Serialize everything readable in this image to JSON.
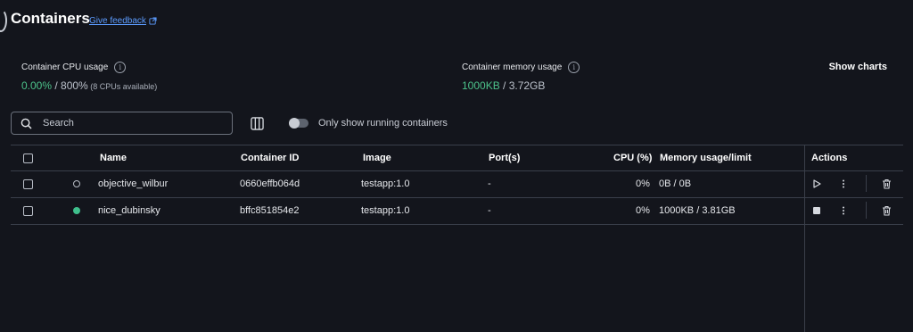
{
  "header": {
    "title": "Containers",
    "feedback_link": "Give feedback"
  },
  "stats": {
    "cpu": {
      "label": "Container CPU usage",
      "value": "0.00%",
      "total": " / 800%",
      "note": " (8 CPUs available)"
    },
    "memory": {
      "label": "Container memory usage",
      "value": "1000KB",
      "total": " / 3.72GB"
    }
  },
  "show_charts_label": "Show charts",
  "search": {
    "placeholder": "Search"
  },
  "toggle_label": "Only show running containers",
  "table": {
    "headers": {
      "name": "Name",
      "container_id": "Container ID",
      "image": "Image",
      "ports": "Port(s)",
      "cpu": "CPU (%)",
      "memory": "Memory usage/limit",
      "actions": "Actions"
    },
    "rows": [
      {
        "name": "objective_wilbur",
        "container_id": "0660effb064d",
        "image": "testapp:1.0",
        "ports": "-",
        "cpu": "0%",
        "memory": "0B / 0B",
        "status": "stopped"
      },
      {
        "name": "nice_dubinsky",
        "container_id": "bffc851854e2",
        "image": "testapp:1.0",
        "ports": "-",
        "cpu": "0%",
        "memory": "1000KB / 3.81GB",
        "status": "running"
      }
    ]
  },
  "colors": {
    "background": "#13151c",
    "running": "#3fbf8c",
    "link": "#5c9cff",
    "usage_value": "#4cc28a"
  }
}
